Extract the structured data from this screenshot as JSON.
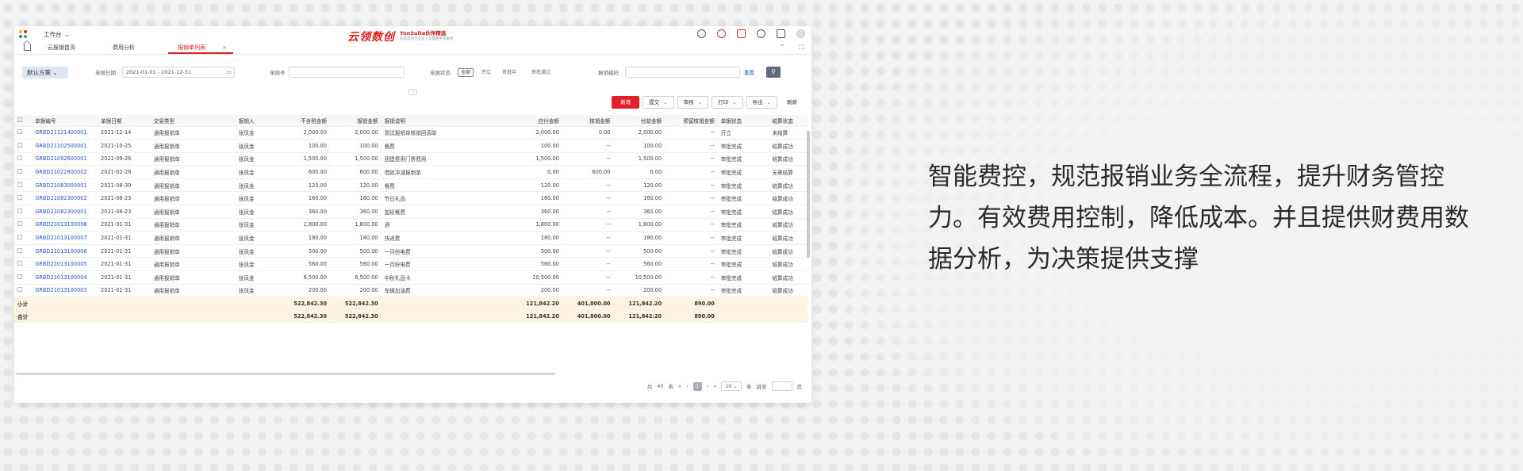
{
  "colors": {
    "accent": "#e0202a",
    "link": "#2858c0",
    "summary_bg": "#fdf3df"
  },
  "topbar": {
    "workbench": "工作台",
    "brand_cn": "云领数创",
    "brand_en": "YonSuite伙伴精选",
    "brand_sub": "智能高效全企业・全面数字化服务"
  },
  "tabs": [
    {
      "label": "云报销首页"
    },
    {
      "label": "费用分析"
    },
    {
      "label": "报销单列表"
    }
  ],
  "filter": {
    "scheme": "默认方案",
    "date_label": "单据日期",
    "date_value": "2021-01-01 - 2021-12-31",
    "creator_label": "单据号",
    "status_label": "单据状态",
    "status_chips": [
      "全部",
      "开立",
      "审批中",
      "审批通过"
    ],
    "code_label": "报销编码",
    "search_link": "重置",
    "search_icon": "search-icon"
  },
  "actions": {
    "new": "新增",
    "submit": "提交",
    "approve": "审核",
    "print": "打印",
    "export": "导出",
    "refresh": "刷新"
  },
  "table": {
    "headers": [
      "单据编号",
      "单据日期",
      "交易类型",
      "报销人",
      "不含税金额",
      "报销金额",
      "报销说明",
      "应付金额",
      "核销金额",
      "付款金额",
      "预留核销金额",
      "单据状态",
      "结算状态"
    ],
    "rows": [
      [
        "GRBD21121400001",
        "2021-12-14",
        "通用报销单",
        "张凤金",
        "2,000.00",
        "2,000.00",
        "测试报销单核销回调单",
        "2,000.00",
        "0.00",
        "2,000.00",
        "--",
        "开立",
        "未结算"
      ],
      [
        "GRBD21102500001",
        "2021-10-25",
        "通用报销单",
        "张凤金",
        "100.00",
        "100.00",
        "餐费",
        "100.00",
        "--",
        "100.00",
        "--",
        "审批完成",
        "结算成功"
      ],
      [
        "GRBD21092600001",
        "2021-09-26",
        "通用报销单",
        "张凤金",
        "1,500.00",
        "1,500.00",
        "团建费用门票费用",
        "1,500.00",
        "--",
        "1,500.00",
        "--",
        "审批完成",
        "结算成功"
      ],
      [
        "GRBD21022800002",
        "2021-02-28",
        "通用报销单",
        "张凤金",
        "600.00",
        "600.00",
        "借款冲减报销单",
        "0.00",
        "600.00",
        "0.00",
        "--",
        "审批完成",
        "无需结算"
      ],
      [
        "GRBD21083000001",
        "2021-08-30",
        "通用报销单",
        "张凤金",
        "120.00",
        "120.00",
        "餐费",
        "120.00",
        "--",
        "120.00",
        "--",
        "审批完成",
        "结算成功"
      ],
      [
        "GRBD21082300002",
        "2021-08-23",
        "通用报销单",
        "张凤金",
        "160.00",
        "160.00",
        "节日礼品",
        "160.00",
        "--",
        "160.00",
        "--",
        "审批完成",
        "结算成功"
      ],
      [
        "GRBD21082300001",
        "2021-08-23",
        "通用报销单",
        "张凤金",
        "360.00",
        "360.00",
        "加班餐费",
        "360.00",
        "--",
        "360.00",
        "--",
        "审批完成",
        "结算成功"
      ],
      [
        "GRBD21013100008",
        "2021-01-31",
        "通用报销单",
        "张凤金",
        "1,800.00",
        "1,800.00",
        "酒",
        "1,800.00",
        "--",
        "1,800.00",
        "--",
        "审批完成",
        "结算成功"
      ],
      [
        "GRBD21013100007",
        "2021-01-31",
        "通用报销单",
        "张凤金",
        "180.00",
        "180.00",
        "快递费",
        "180.00",
        "--",
        "180.00",
        "--",
        "审批完成",
        "结算成功"
      ],
      [
        "GRBD21013100006",
        "2021-01-31",
        "通用报销单",
        "张凤金",
        "500.00",
        "500.00",
        "一月份电费",
        "500.00",
        "--",
        "500.00",
        "--",
        "审批完成",
        "结算成功"
      ],
      [
        "GRBD21013100005",
        "2021-01-31",
        "通用报销单",
        "张凤金",
        "560.00",
        "560.00",
        "一月份电费",
        "560.00",
        "--",
        "560.00",
        "--",
        "审批完成",
        "结算成功"
      ],
      [
        "GRBD21013100004",
        "2021-01-31",
        "通用报销单",
        "张凤金",
        "6,500.00",
        "6,500.00",
        "中秋礼品卡",
        "10,500.00",
        "--",
        "10,500.00",
        "--",
        "审批完成",
        "结算成功"
      ],
      [
        "GRBD21013100003",
        "2021-01-31",
        "通用报销单",
        "张凤金",
        "200.00",
        "200.00",
        "车辆加油费",
        "200.00",
        "--",
        "200.00",
        "--",
        "审批完成",
        "结算成功"
      ]
    ],
    "subtotal": {
      "label": "小计",
      "amt_ex_tax": "522,842.30",
      "amt": "522,842.30",
      "payable": "121,842.20",
      "writeoff": "401,800.00",
      "paid": "121,842.20",
      "reserved": "890.00"
    },
    "total": {
      "label": "合计",
      "amt_ex_tax": "522,842.30",
      "amt": "522,842.30",
      "payable": "121,842.20",
      "writeoff": "401,800.00",
      "paid": "121,842.20",
      "reserved": "890.00"
    }
  },
  "pager": {
    "total_prefix": "共",
    "total_count": "40",
    "total_suffix": "条",
    "current": "1",
    "page_size": "20",
    "page_size_suffix": "条",
    "goto_label": "跳至",
    "page_unit": "页"
  },
  "promo": {
    "line1": "智能费控，规范报销业务全流程，提升财务管控",
    "line2": "力。有效费用控制，降低成本。并且提供财费用数",
    "line3": "据分析，为决策提供支撑"
  }
}
